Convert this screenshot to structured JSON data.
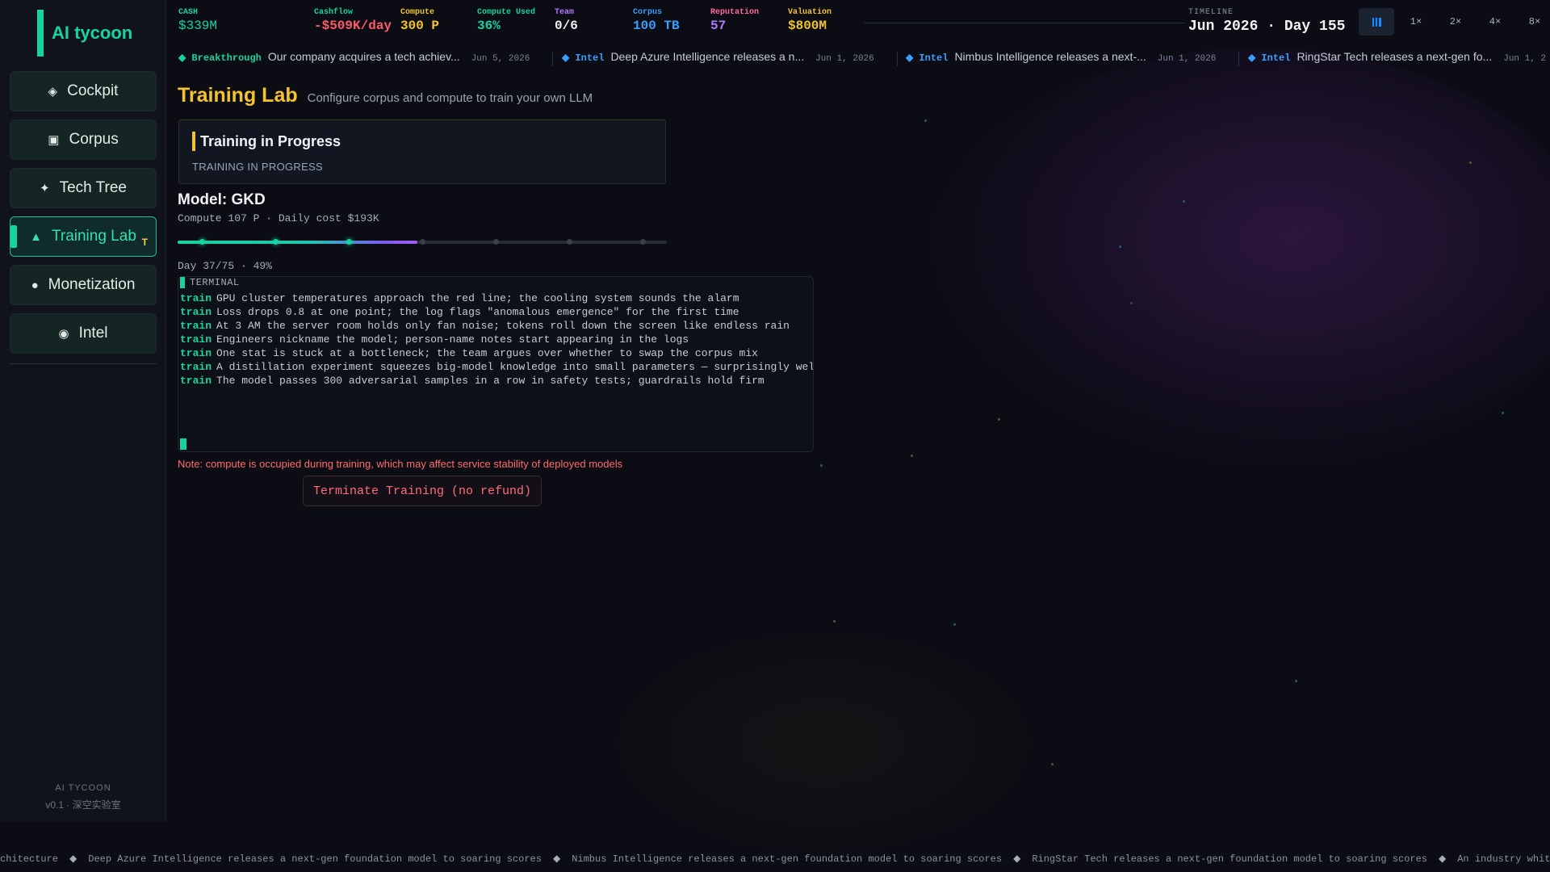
{
  "app": {
    "title": "AI tycoon",
    "footer_name": "AI TYCOON",
    "footer_version": "v0.1 · 深空实验室"
  },
  "nav": [
    {
      "icon": "diamond-icon",
      "glyph": "◈",
      "label": "Cockpit"
    },
    {
      "icon": "square-icon",
      "glyph": "▣",
      "label": "Corpus"
    },
    {
      "icon": "sparkle-icon",
      "glyph": "✦",
      "label": "Tech Tree"
    },
    {
      "icon": "triangle-icon",
      "glyph": "▲",
      "label": "Training Lab",
      "hotkey": "T",
      "active": true
    },
    {
      "icon": "dot-icon",
      "glyph": "●",
      "label": "Monetization"
    },
    {
      "icon": "radio-icon",
      "glyph": "◉",
      "label": "Intel"
    }
  ],
  "stats": {
    "cash": {
      "label": "CASH",
      "value": "$339M",
      "color": "#16d4a0"
    },
    "cashflow": {
      "label": "Cashflow",
      "value": "-$509K/day",
      "color": "#ff5a6a"
    },
    "compute": {
      "label": "Compute",
      "value": "300 P",
      "color": "#f4c430"
    },
    "compute_used": {
      "label": "Compute Used",
      "value": "36%",
      "color": "#16d4a0"
    },
    "team": {
      "label": "Team",
      "value": "0/6",
      "color": "#b07cff",
      "value_color": "#f0f2f6"
    },
    "corpus": {
      "label": "Corpus",
      "value": "100 TB",
      "color": "#3aa0ff"
    },
    "reputation": {
      "label": "Reputation",
      "value": "57",
      "color": "#ff6b9a",
      "value_color": "#b07cff"
    },
    "valuation": {
      "label": "Valuation",
      "value": "$800M",
      "color": "#f4c430"
    }
  },
  "timeline": {
    "label": "TIMELINE",
    "value": "Jun 2026 · Day 155"
  },
  "speeds": [
    "1×",
    "2×",
    "4×",
    "8×"
  ],
  "news": [
    {
      "tag": "◆ Breakthrough",
      "tag_color": "#16d4a0",
      "text": "Our company acquires a tech achiev...",
      "date": "Jun 5, 2026"
    },
    {
      "tag": "◆ Intel",
      "tag_color": "#3aa0ff",
      "text": "Deep Azure Intelligence releases a n...",
      "date": "Jun 1, 2026"
    },
    {
      "tag": "◆ Intel",
      "tag_color": "#3aa0ff",
      "text": "Nimbus Intelligence releases a next-...",
      "date": "Jun 1, 2026"
    },
    {
      "tag": "◆ Intel",
      "tag_color": "#3aa0ff",
      "text": "RingStar Tech releases a next-gen fo...",
      "date": "Jun 1, 2"
    }
  ],
  "page": {
    "title": "Training Lab",
    "subtitle": "Configure corpus and compute to train your own LLM"
  },
  "status_card": {
    "title": "Training in Progress",
    "subtitle": "TRAINING IN PROGRESS"
  },
  "model": {
    "title": "Model: GKD",
    "meta": "Compute 107 P · Daily cost $193K",
    "day_line": "Day 37/75 · 49%",
    "progress": 0.49,
    "milestones": [
      0.05,
      0.2,
      0.35,
      0.5,
      0.65,
      0.8,
      0.95
    ]
  },
  "terminal": {
    "header": "TERMINAL",
    "keyword": "train",
    "lines": [
      "GPU cluster temperatures approach the red line; the cooling system sounds the alarm",
      "Loss drops 0.8 at one point; the log flags \"anomalous emergence\" for the first time",
      "At 3 AM the server room holds only fan noise; tokens roll down the screen like endless rain",
      "Engineers nickname the model; person-name notes start appearing in the logs",
      "One stat is stuck at a bottleneck; the team argues over whether to swap the corpus mix",
      "A distillation experiment squeezes big-model knowledge into small parameters — surprisingly well",
      "The model passes 300 adversarial samples in a row in safety tests; guardrails hold firm"
    ]
  },
  "note": "Note: compute is occupied during training, which may affect service stability of deployed models",
  "terminate_label": "Terminate Training (no refund)",
  "ticker": [
    "chitecture",
    "Deep Azure Intelligence releases a next-gen foundation model to soaring scores",
    "Nimbus Intelligence releases a next-gen foundation model to soaring scores",
    "RingStar Tech releases a next-gen foundation model to soaring scores",
    "An industry whitepaper argues synthetic"
  ]
}
